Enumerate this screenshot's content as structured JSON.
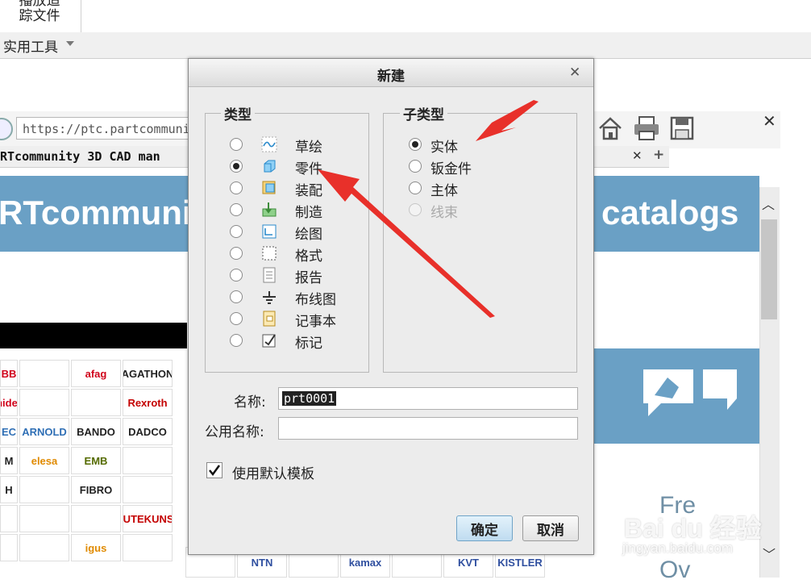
{
  "ribbon": {
    "playback_label_1": "播放追",
    "playback_label_2": "踪文件",
    "tools_menu": "实用工具"
  },
  "browser": {
    "url": "https://ptc.partcommuni",
    "tab_title": "RTcommunity 3D CAD man",
    "banner_left": "RTcommuni",
    "banner_right": "catalogs",
    "free_text": "Fre",
    "ov_text": "Ov",
    "logos": [
      "BB",
      "",
      "afag",
      "AGATHON",
      "nider",
      "",
      "",
      "Rexroth",
      "EC",
      "ARNOLD",
      "BANDO",
      "DADCO",
      "M",
      "elesa",
      "EMB",
      "",
      "H",
      "",
      "FIBRO",
      "",
      "",
      "",
      "",
      "GUTEKUNST",
      "",
      "",
      "igus",
      ""
    ],
    "logos_bottom": [
      "",
      "NTN",
      "",
      "kamax",
      "",
      "KVT",
      "KISTLER"
    ]
  },
  "dialog": {
    "title": "新建",
    "type_group_title": "类型",
    "subtype_group_title": "子类型",
    "types": [
      {
        "label": "草绘",
        "icon": "sketch-icon",
        "selected": false
      },
      {
        "label": "零件",
        "icon": "part-icon",
        "selected": true
      },
      {
        "label": "装配",
        "icon": "assembly-icon",
        "selected": false
      },
      {
        "label": "制造",
        "icon": "manufacturing-icon",
        "selected": false
      },
      {
        "label": "绘图",
        "icon": "drawing-icon",
        "selected": false
      },
      {
        "label": "格式",
        "icon": "format-icon",
        "selected": false
      },
      {
        "label": "报告",
        "icon": "report-icon",
        "selected": false
      },
      {
        "label": "布线图",
        "icon": "diagram-icon",
        "selected": false
      },
      {
        "label": "记事本",
        "icon": "notebook-icon",
        "selected": false
      },
      {
        "label": "标记",
        "icon": "markup-icon",
        "selected": false
      }
    ],
    "subtypes": [
      {
        "label": "实体",
        "selected": true,
        "disabled": false
      },
      {
        "label": "钣金件",
        "selected": false,
        "disabled": false
      },
      {
        "label": "主体",
        "selected": false,
        "disabled": false
      },
      {
        "label": "线束",
        "selected": false,
        "disabled": true
      }
    ],
    "name_label": "名称:",
    "name_value": "prt0001",
    "common_name_label": "公用名称:",
    "common_name_value": "",
    "use_default_template_label": "使用默认模板",
    "use_default_template_checked": true,
    "ok_label": "确定",
    "cancel_label": "取消"
  },
  "watermark": {
    "main": "Bai du 经验",
    "sub": "jingyan.baidu.com"
  },
  "colors": {
    "banner": "#6aa0c5",
    "arrow": "#e8302a",
    "ok_button": "#bfdcf0"
  }
}
